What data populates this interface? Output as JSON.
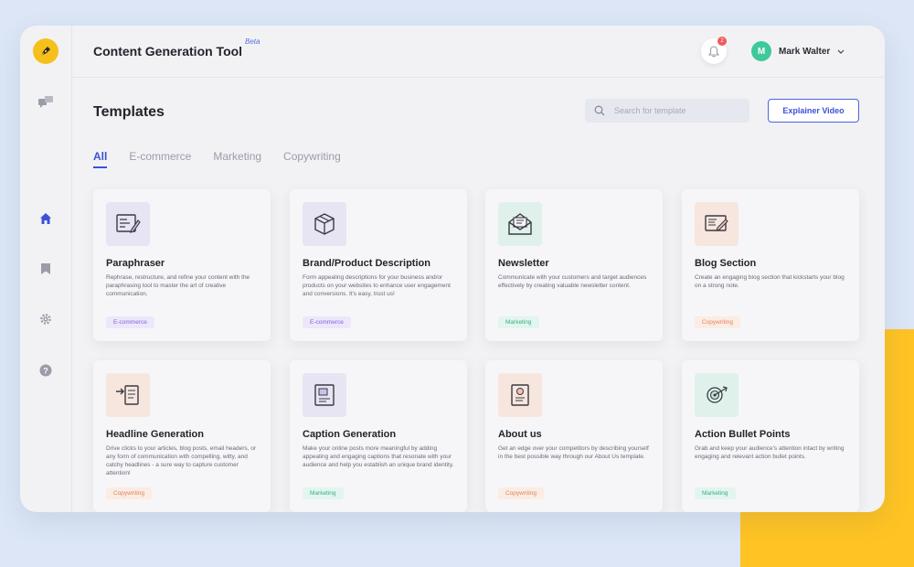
{
  "app": {
    "title": "Content Generation Tool",
    "badge": "Beta"
  },
  "colors": {
    "accent": "#3b52d6",
    "brand_yellow": "#f6c01c",
    "notification": "#f25a5a"
  },
  "sidebar": {
    "items": [
      {
        "name": "chat",
        "icon": "chat-bubbles-icon"
      },
      {
        "name": "home",
        "icon": "home-icon",
        "active": true
      },
      {
        "name": "saved",
        "icon": "bookmark-icon"
      },
      {
        "name": "settings",
        "icon": "gear-icon"
      },
      {
        "name": "help",
        "icon": "help-icon"
      }
    ]
  },
  "header": {
    "notifications_count": "2",
    "user": {
      "initial": "M",
      "name": "Mark Walter"
    }
  },
  "main": {
    "title": "Templates",
    "search_placeholder": "Search for template",
    "explainer_label": "Explainer Video",
    "tabs": [
      {
        "label": "All",
        "active": true
      },
      {
        "label": "E-commerce"
      },
      {
        "label": "Marketing"
      },
      {
        "label": "Copywriting"
      }
    ]
  },
  "templates": [
    {
      "title": "Paraphraser",
      "description": "Rephrase, restructure, and refine your content with the paraphrasing tool to master the art of creative communication.",
      "tag": "E-commerce",
      "icon": "document-edit-icon"
    },
    {
      "title": "Brand/Product Description",
      "description": "Form appealing descriptions for your business and/or products on your websites to enhance user engagement and conversions. It's easy, trust us!",
      "tag": "E-commerce",
      "icon": "package-box-icon"
    },
    {
      "title": "Newsletter",
      "description": "Communicate with your customers and target audiences effectively by creating valuable newsletter content.",
      "tag": "Marketing",
      "icon": "envelope-open-icon"
    },
    {
      "title": "Blog Section",
      "description": "Create an engaging blog section that kickstarts your blog on a strong note.",
      "tag": "Copywriting",
      "icon": "blog-pencil-icon"
    },
    {
      "title": "Headline Generation",
      "description": "Drive clicks to your articles, blog posts, email headers, or any form of communication with compelling, witty, and catchy headlines - a sure way to capture customer attention!",
      "tag": "Copywriting",
      "icon": "headline-arrow-icon"
    },
    {
      "title": "Caption Generation",
      "description": "Make your online posts more meaningful by adding appealing and engaging captions that resonate with your audience and help you establish an unique brand identity.",
      "tag": "Marketing",
      "icon": "image-caption-icon"
    },
    {
      "title": "About us",
      "description": "Get an edge over your competitors by describing yourself in the best possible way through our About Us template.",
      "tag": "Copywriting",
      "icon": "about-document-icon"
    },
    {
      "title": "Action Bullet Points",
      "description": "Grab and keep your audience's attention intact by writing engaging and relevant action bullet points.",
      "tag": "Marketing",
      "icon": "target-arrow-icon"
    }
  ]
}
